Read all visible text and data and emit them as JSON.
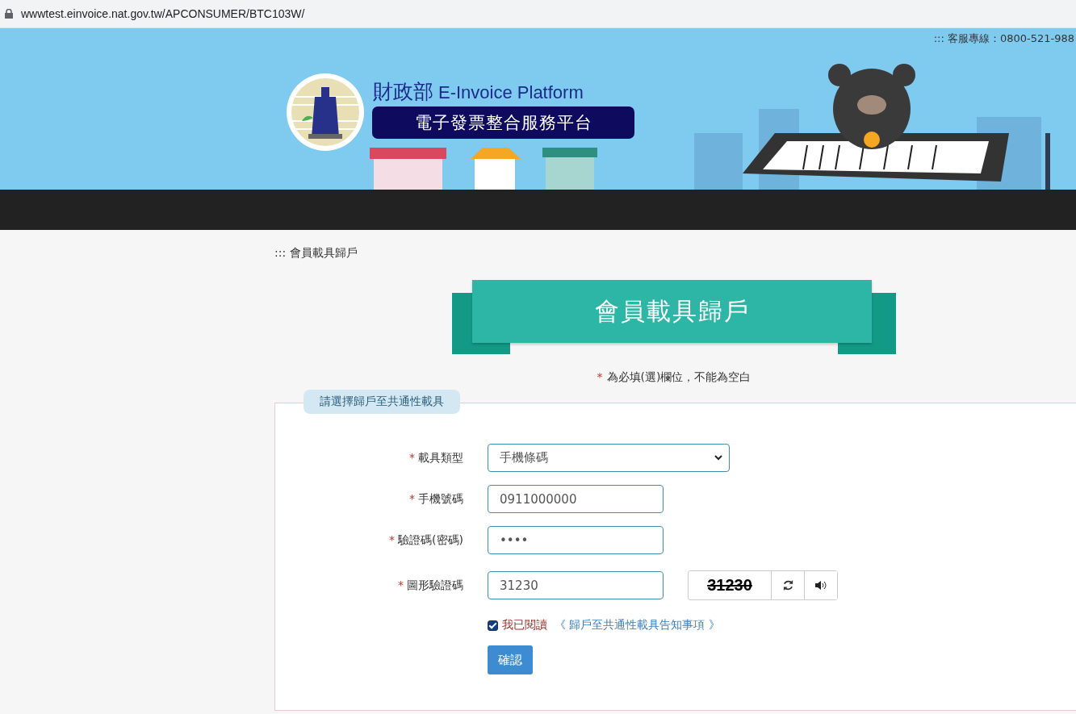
{
  "browser": {
    "url": "wwwtest.einvoice.nat.gov.tw/APCONSUMER/BTC103W/"
  },
  "banner": {
    "hotline": "::: 客服專線：0800-521-988",
    "ministry": "財政部",
    "platform_en": "E-Invoice Platform",
    "platform_zh": "電子發票整合服務平台"
  },
  "breadcrumb": "::: 會員載具歸戶",
  "page_title": "會員載具歸戶",
  "required_note": {
    "mark": "*",
    "text": "為必填(選)欄位，不能為空白"
  },
  "form": {
    "legend": "請選擇歸戶至共通性載具",
    "fields": [
      {
        "kind": "select",
        "mark": "*",
        "label": "載具類型",
        "value": "手機條碼"
      },
      {
        "kind": "text",
        "mark": "*",
        "label": "手機號碼",
        "value": "0911000000"
      },
      {
        "kind": "text",
        "mark": "*",
        "label": "驗證碼(密碼)",
        "value": "••••"
      },
      {
        "kind": "captcha",
        "mark": "*",
        "label": "圖形驗證碼",
        "value": "31230",
        "captcha_text": "31230"
      }
    ],
    "agree": {
      "checked": true,
      "label": "我已閱讀",
      "link": "《 歸戶至共通性載具告知事項 》"
    },
    "submit": "確認"
  }
}
